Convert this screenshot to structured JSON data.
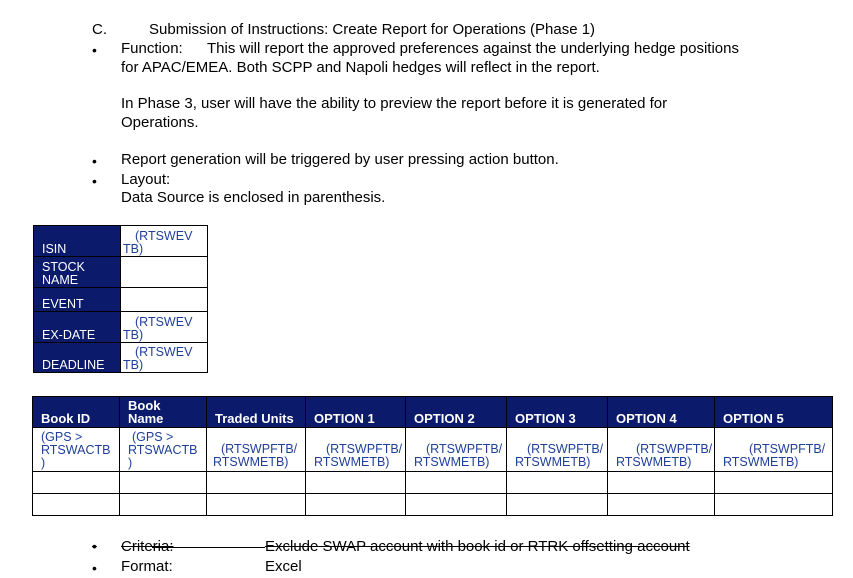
{
  "section": {
    "letter": "C.",
    "title": "Submission of Instructions:  Create Report for Operations (Phase 1)"
  },
  "bullets": {
    "function_label": "Function:",
    "function_line1": "This will report the approved preferences against the underlying hedge positions",
    "function_line2": "for APAC/EMEA.  Both SCPP and Napoli hedges will reflect in the report.",
    "phase3_line1": "In Phase 3, user will have the ability to preview the report before it is generated for",
    "phase3_line2": "Operations.",
    "report_generation": "Report generation will be triggered by user pressing action button.",
    "layout_label": "Layout:",
    "data_source_note": "Data Source is enclosed in parenthesis.",
    "bullet_char": "•"
  },
  "summary_table": {
    "rows": [
      {
        "label": "ISIN",
        "value_line1": "(RTSWEV",
        "value_line2": "TB)"
      },
      {
        "label_line1": "STOCK",
        "label_line2": "NAME",
        "value_line1": "",
        "value_line2": ""
      },
      {
        "label": "EVENT",
        "value_line1": "",
        "value_line2": ""
      },
      {
        "label": "EX-DATE",
        "value_line1": "(RTSWEV",
        "value_line2": "TB)"
      },
      {
        "label": "DEADLINE",
        "value_line1": "(RTSWEV",
        "value_line2": "TB)"
      }
    ]
  },
  "report_table": {
    "headers": [
      {
        "line1": "",
        "line2": "Book ID"
      },
      {
        "line1": "Book",
        "line2": "Name"
      },
      {
        "line1": "",
        "line2": "Traded Units"
      },
      {
        "line1": "",
        "line2": "OPTION 1"
      },
      {
        "line1": "",
        "line2": "OPTION 2"
      },
      {
        "line1": "",
        "line2": "OPTION 3"
      },
      {
        "line1": "",
        "line2": "OPTION 4"
      },
      {
        "line1": "",
        "line2": "OPTION 5"
      }
    ],
    "sources": [
      {
        "line1": "(GPS >",
        "line2": "RTSWACTB",
        "line3": ")"
      },
      {
        "line1": "(GPS >",
        "line2": "RTSWACTB",
        "line3": ")"
      },
      {
        "line1": "(RTSWPFTB/",
        "line2": "RTSWMETB)",
        "line3": ""
      },
      {
        "line1": "(RTSWPFTB/",
        "line2": "RTSWMETB)",
        "line3": ""
      },
      {
        "line1": "(RTSWPFTB/",
        "line2": "RTSWMETB)",
        "line3": ""
      },
      {
        "line1": "(RTSWPFTB/",
        "line2": "RTSWMETB)",
        "line3": ""
      },
      {
        "line1": "(RTSWPFTB/",
        "line2": "RTSWMETB)",
        "line3": ""
      },
      {
        "line1": "(RTSWPFTB/",
        "line2": "RTSWMETB)",
        "line3": ""
      }
    ]
  },
  "footer": {
    "criteria_label": "Criteria:",
    "criteria_value": "Exclude SWAP account with book id or RTRK offsetting account",
    "format_label": "Format:",
    "format_value": "Excel"
  },
  "colors": {
    "header_bg": "#0b1a6b",
    "source_text": "#1f3f99"
  }
}
